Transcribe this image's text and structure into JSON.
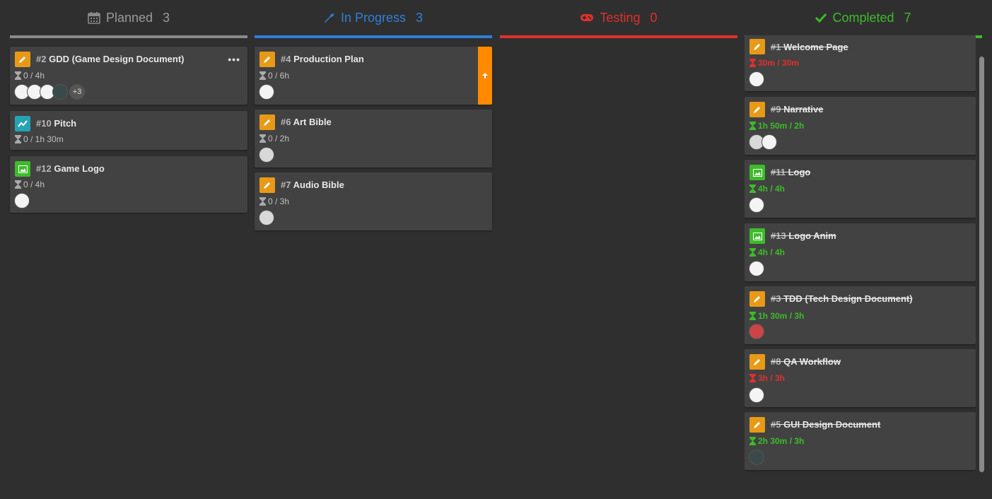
{
  "colors": {
    "planned": "#8a8a8a",
    "in_progress": "#2f7fd8",
    "testing": "#e0302d",
    "completed": "#3dbb2a",
    "pencil_badge": "#e89a16",
    "chart_badge": "#25a3b5",
    "image_badge": "#3dbb2a",
    "overdue": "#e0302d",
    "ontime": "#3dbb2a"
  },
  "columns": [
    {
      "key": "planned",
      "title": "Planned",
      "count": "3",
      "icon": "calendar-icon",
      "cards": [
        {
          "type": "pencil-icon",
          "num": "#2",
          "title": "GDD (Game Design Document)",
          "time": "0 / 4h",
          "avatars": [
            "light",
            "light",
            "light",
            "dark"
          ],
          "more": "+3",
          "menu": true
        },
        {
          "type": "chart-icon",
          "num": "#10",
          "title": "Pitch",
          "time": "0 / 1h 30m",
          "avatars": []
        },
        {
          "type": "image-icon",
          "num": "#12",
          "title": "Game Logo",
          "time": "0 / 4h",
          "avatars": [
            "light"
          ]
        }
      ]
    },
    {
      "key": "in_progress",
      "title": "In Progress",
      "count": "3",
      "icon": "wrench-icon",
      "cards": [
        {
          "type": "pencil-icon",
          "num": "#4",
          "title": "Production Plan",
          "time": "0 / 6h",
          "avatars": [
            "light"
          ],
          "flag": true
        },
        {
          "type": "pencil-icon",
          "num": "#6",
          "title": "Art Bible",
          "time": "0 / 2h",
          "avatars": [
            "plain"
          ]
        },
        {
          "type": "pencil-icon",
          "num": "#7",
          "title": "Audio Bible",
          "time": "0 / 3h",
          "avatars": [
            "plain"
          ]
        }
      ]
    },
    {
      "key": "testing",
      "title": "Testing",
      "count": "0",
      "icon": "gamepad-icon",
      "cards": []
    },
    {
      "key": "completed",
      "title": "Completed",
      "count": "7",
      "icon": "check-icon",
      "cards": [
        {
          "type": "pencil-icon",
          "num": "#1",
          "title": "Welcome Page",
          "time": "30m / 30m",
          "status": "overdue",
          "avatars": [
            "light"
          ]
        },
        {
          "type": "pencil-icon",
          "num": "#9",
          "title": "Narrative",
          "time": "1h 50m / 2h",
          "status": "ontime",
          "avatars": [
            "plain",
            "light"
          ]
        },
        {
          "type": "image-icon",
          "num": "#11",
          "title": "Logo",
          "time": "4h / 4h",
          "status": "ontime",
          "avatars": [
            "light"
          ]
        },
        {
          "type": "image-icon",
          "num": "#13",
          "title": "Logo Anim",
          "time": "4h / 4h",
          "status": "ontime",
          "avatars": [
            "light"
          ]
        },
        {
          "type": "pencil-icon",
          "num": "#3",
          "title": "TDD (Tech Design Document)",
          "time": "1h 30m / 3h",
          "status": "ontime",
          "avatars": [
            "red"
          ]
        },
        {
          "type": "pencil-icon",
          "num": "#8",
          "title": "QA Workflow",
          "time": "3h / 3h",
          "status": "overdue",
          "avatars": [
            "light"
          ]
        },
        {
          "type": "pencil-icon",
          "num": "#5",
          "title": "GUI Design Document",
          "time": "2h 30m / 3h",
          "status": "ontime",
          "avatars": [
            "dark"
          ]
        }
      ]
    }
  ]
}
